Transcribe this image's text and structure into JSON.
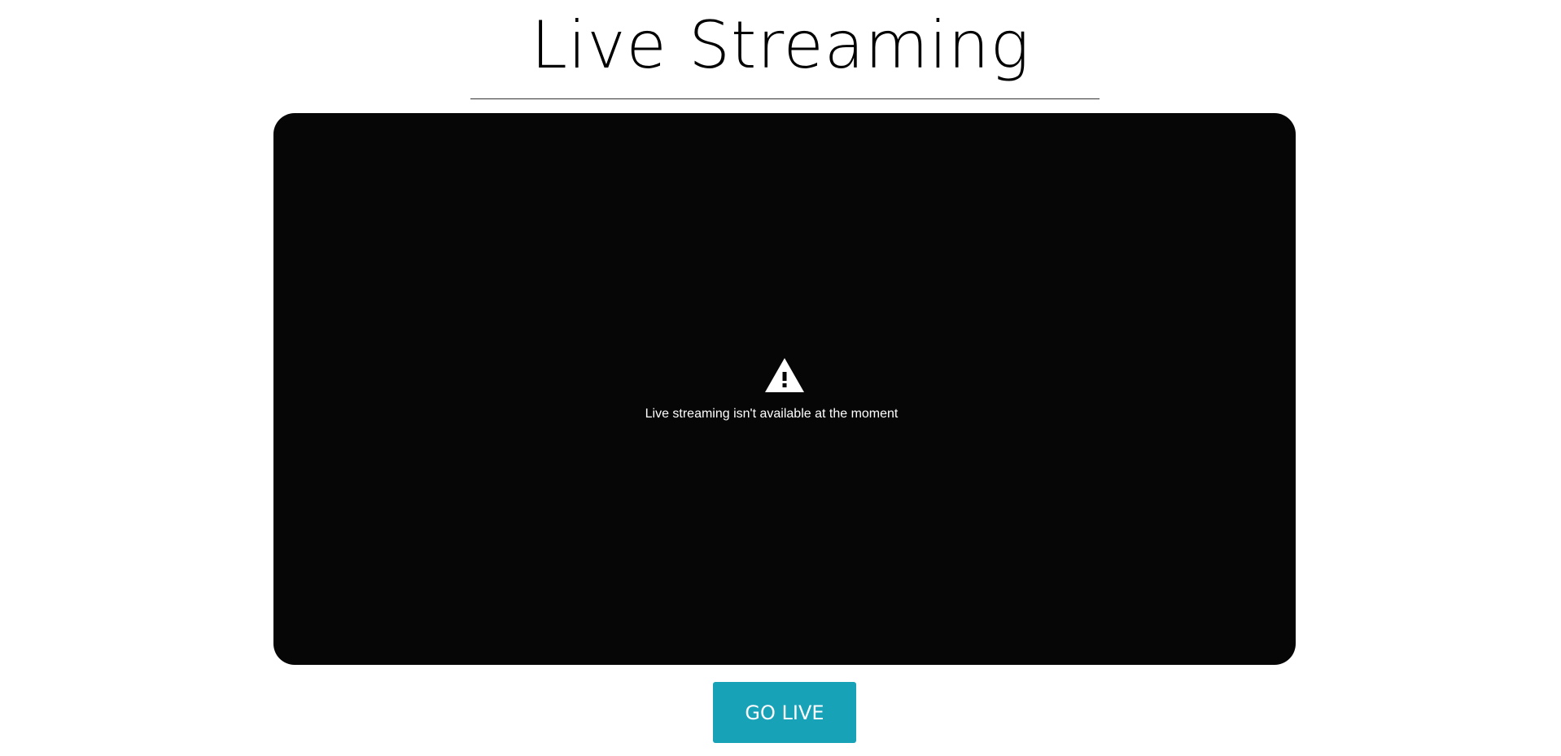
{
  "page": {
    "title": "Live Streaming"
  },
  "video_player": {
    "error_icon": "warning-icon",
    "error_message": "Live streaming isn't available at the moment",
    "background_color": "#060606"
  },
  "actions": {
    "go_live_label": "GO LIVE",
    "go_live_color": "#17a2b8"
  }
}
